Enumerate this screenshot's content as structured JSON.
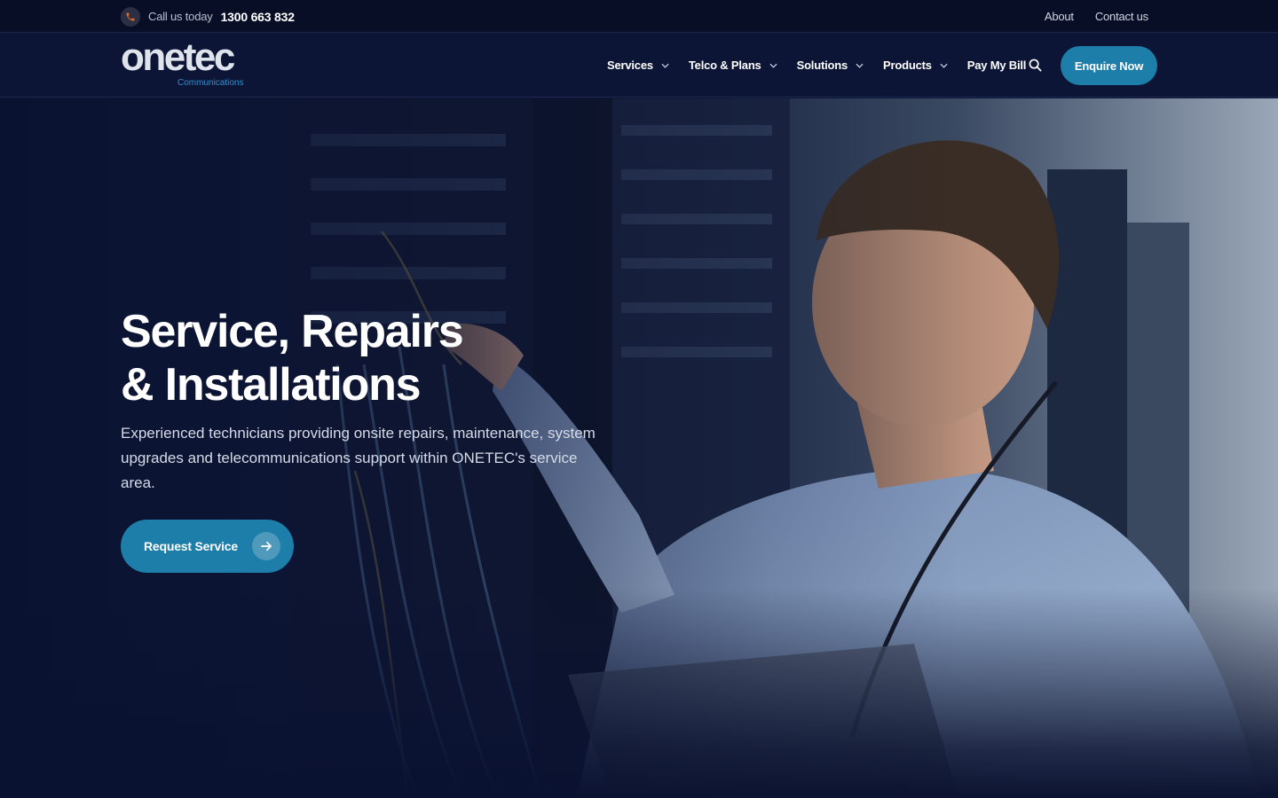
{
  "topbar": {
    "call_label": "Call us today",
    "phone_number": "1300 663 832",
    "links": [
      "About",
      "Contact us"
    ]
  },
  "brand": {
    "name": "onetec",
    "tagline": "Communications",
    "accent": "#2f8fd0"
  },
  "nav": {
    "items": [
      {
        "label": "Services",
        "dropdown": true
      },
      {
        "label": "Telco & Plans",
        "dropdown": true
      },
      {
        "label": "Solutions",
        "dropdown": true
      },
      {
        "label": "Products",
        "dropdown": true
      },
      {
        "label": "Pay My Bill",
        "dropdown": false
      }
    ],
    "search_icon": "search-icon",
    "cta_label": "Enquire Now"
  },
  "hero": {
    "title_line1": "Service, Repairs",
    "title_line2": "& Installations",
    "description": "Experienced technicians providing onsite repairs, maintenance, system upgrades and telecommunications support within ONETEC's service area.",
    "cta_label": "Request Service",
    "cta_icon": "arrow-right-icon"
  },
  "colors": {
    "page_bg": "#0b1330",
    "topbar_bg": "#080e26",
    "navbar_bg": "#0c1535",
    "button": "#1e7eaa",
    "phone_icon": "#e0642b"
  }
}
